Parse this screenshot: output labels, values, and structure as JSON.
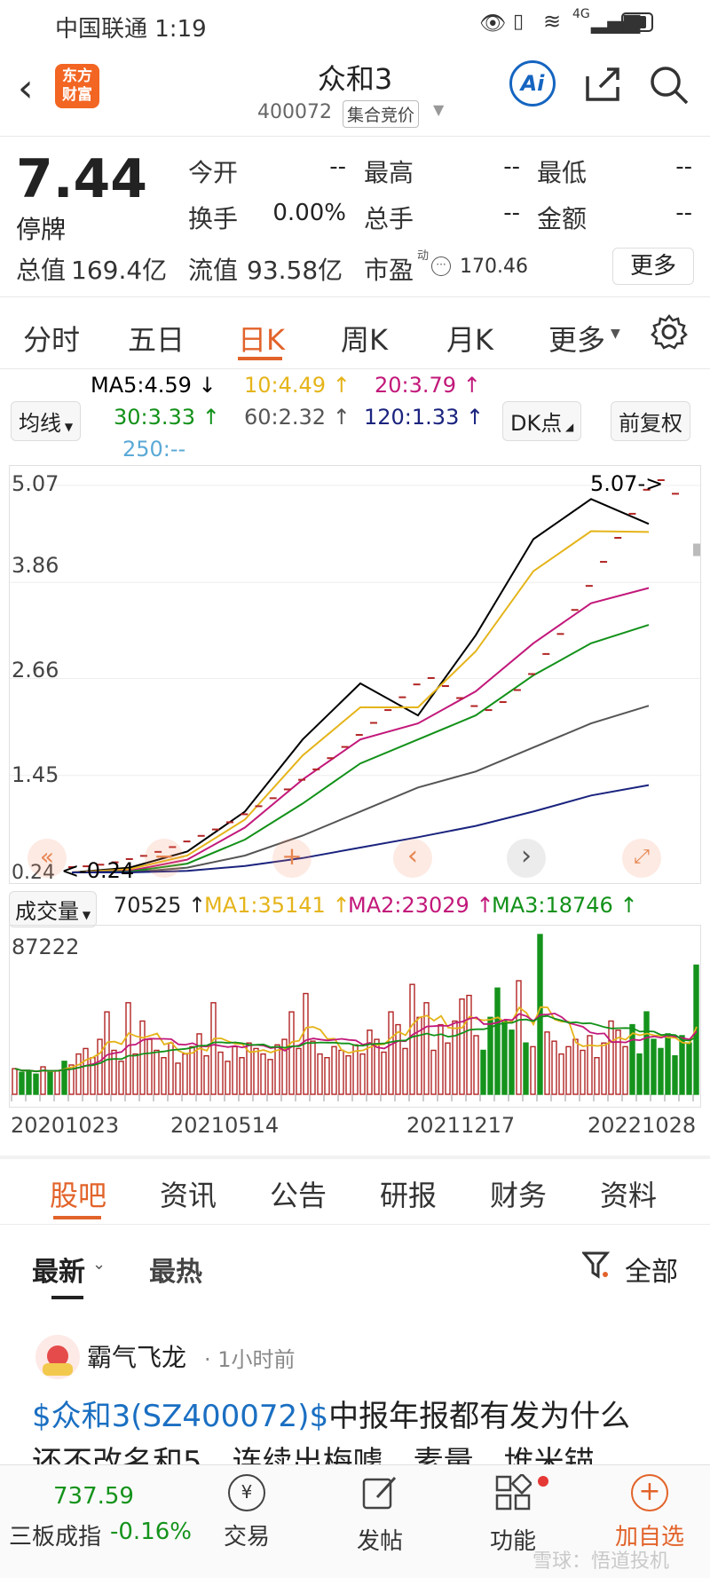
{
  "status": {
    "carrier_time": "中国联通 1:19",
    "network": "4G"
  },
  "header": {
    "logo_text": "东方\n财富",
    "stock_name": "众和3",
    "stock_code": "400072",
    "market_tag": "集合竞价",
    "ai_label": "Ai"
  },
  "quote": {
    "price": "7.44",
    "status": "停牌",
    "stats": [
      {
        "label": "今开",
        "value": "--"
      },
      {
        "label": "最高",
        "value": "--"
      },
      {
        "label": "最低",
        "value": "--"
      },
      {
        "label": "换手",
        "value": "0.00%"
      },
      {
        "label": "总手",
        "value": "--"
      },
      {
        "label": "金额",
        "value": "--"
      }
    ],
    "total_value_label": "总值",
    "total_value": "169.4亿",
    "float_value_label": "流值",
    "float_value": "93.58亿",
    "pe_label": "市盈",
    "pe_sup": "动",
    "pe_value": "170.46",
    "more_button": "更多"
  },
  "tabs": {
    "items": [
      "分时",
      "五日",
      "日K",
      "周K",
      "月K",
      "更多"
    ],
    "active": "日K"
  },
  "ma": {
    "selector": "均线",
    "ma5": "MA5:4.59 ↓",
    "ma10": "10:4.49 ↑",
    "ma20": "20:3.79 ↑",
    "ma30": "30:3.33 ↑",
    "ma60": "60:2.32 ↑",
    "ma120": "120:1.33 ↑",
    "ma250": "250:--",
    "dk_button": "DK点",
    "adjust_button": "前复权",
    "colors": {
      "ma5": "#000000",
      "ma10": "#e5b41a",
      "ma20": "#c2187a",
      "ma30": "#129119",
      "ma60": "#555555",
      "ma120": "#1a237e",
      "ma250": "#5aa9d6"
    }
  },
  "chart_data": [
    {
      "type": "line",
      "y_ticks": [
        "5.07",
        "3.86",
        "2.66",
        "1.45",
        "0.24"
      ],
      "ylim": [
        0.24,
        5.07
      ],
      "annotations": [
        "5.07->",
        "<-0.24"
      ],
      "x": [
        "20201023",
        "20210514",
        "20211217",
        "20221028"
      ],
      "series": [
        {
          "name": "MA5",
          "values": [
            0.24,
            0.3,
            0.5,
            1.0,
            1.9,
            2.6,
            2.2,
            3.2,
            4.4,
            4.9,
            4.59
          ]
        },
        {
          "name": "10",
          "values": [
            0.24,
            0.28,
            0.45,
            0.9,
            1.7,
            2.3,
            2.3,
            3.0,
            4.0,
            4.5,
            4.49
          ]
        },
        {
          "name": "20",
          "values": [
            0.24,
            0.26,
            0.4,
            0.8,
            1.4,
            1.9,
            2.1,
            2.5,
            3.1,
            3.6,
            3.79
          ]
        },
        {
          "name": "30",
          "values": [
            0.24,
            0.25,
            0.35,
            0.65,
            1.1,
            1.6,
            1.9,
            2.2,
            2.7,
            3.1,
            3.33
          ]
        },
        {
          "name": "60",
          "values": [
            0.24,
            0.24,
            0.3,
            0.45,
            0.7,
            1.0,
            1.3,
            1.5,
            1.8,
            2.1,
            2.32
          ]
        },
        {
          "name": "120",
          "values": [
            0.24,
            0.24,
            0.26,
            0.32,
            0.42,
            0.55,
            0.68,
            0.82,
            1.0,
            1.2,
            1.33
          ]
        }
      ],
      "dash_values": [
        0.24,
        0.25,
        0.27,
        0.3,
        0.34,
        0.38,
        0.43,
        0.49,
        0.56,
        0.63,
        0.71,
        0.8,
        0.9,
        1.0,
        1.1,
        1.21,
        1.33,
        1.46,
        1.6,
        1.74,
        1.89,
        2.04,
        2.2,
        2.36,
        2.52,
        2.6,
        2.5,
        2.35,
        2.25,
        2.2,
        2.3,
        2.45,
        2.65,
        2.9,
        3.15,
        3.45,
        3.75,
        4.05,
        4.35,
        4.65,
        4.95,
        5.07,
        4.9
      ]
    },
    {
      "type": "bar",
      "title": "成交量",
      "latest": "70525 ↑",
      "mas": [
        "MA1:35141 ↑",
        "MA2:23029 ↑",
        "MA3:18746 ↑"
      ],
      "ymax_label": "87222",
      "ylim": [
        0,
        87222
      ],
      "values": [
        14000,
        12000,
        13000,
        11000,
        15000,
        12000,
        13000,
        18000,
        16000,
        22000,
        25000,
        20000,
        30000,
        45000,
        24000,
        18000,
        50000,
        22000,
        40000,
        30000,
        24000,
        20000,
        28000,
        17000,
        22000,
        26000,
        33000,
        21000,
        50000,
        23000,
        18000,
        26000,
        20000,
        28000,
        25000,
        22000,
        19000,
        27000,
        30000,
        45000,
        25000,
        55000,
        29000,
        22000,
        20000,
        26000,
        24000,
        21000,
        27000,
        22000,
        35000,
        30000,
        23000,
        45000,
        38000,
        25000,
        60000,
        42000,
        50000,
        24000,
        38000,
        28000,
        40000,
        52000,
        54000,
        32000,
        24000,
        42000,
        58000,
        40000,
        35000,
        62000,
        28000,
        26000,
        87222,
        34000,
        29000,
        22000,
        26000,
        30000,
        24000,
        32000,
        20000,
        28000,
        40000,
        35000,
        26000,
        38000,
        22000,
        45000,
        30000,
        25000,
        33000,
        21000,
        32000,
        28000,
        70525
      ],
      "green_idx": [
        1,
        2,
        3,
        5,
        7,
        66,
        67,
        68,
        69,
        70,
        72,
        74,
        87,
        88,
        89,
        90,
        91,
        92,
        93,
        94,
        95,
        96
      ],
      "colors": {
        "up": "#b22424",
        "down": "#15931c",
        "ma1": "#e5b41a",
        "ma2": "#c2187a",
        "ma3": "#129119"
      }
    }
  ],
  "toolbar": {
    "selector_label": "成交量"
  },
  "social_tabs": {
    "items": [
      "股吧",
      "资讯",
      "公告",
      "研报",
      "财务",
      "资料"
    ],
    "active": "股吧"
  },
  "filter": {
    "latest": "最新",
    "hot": "最热",
    "all": "全部"
  },
  "post": {
    "author": "霸气飞龙",
    "time": "· 1小时前",
    "link": "$众和3(SZ400072)$",
    "text": "中报年报都有发为什么",
    "second_line": "还不改名和5，连续出梅噱，素量，堆米锚"
  },
  "bottom": {
    "index_value": "737.59",
    "index_name": "三板成指",
    "index_change": "-0.16%",
    "items": [
      "交易",
      "发帖",
      "功能",
      "加自选"
    ],
    "watermark": "雪球：悟道投机"
  }
}
